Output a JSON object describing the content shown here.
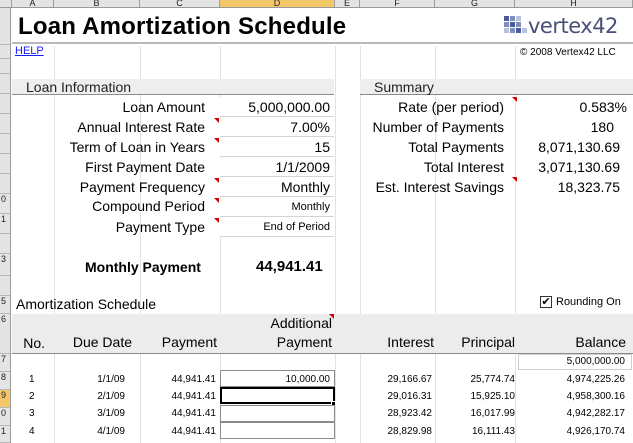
{
  "app": {
    "columns": [
      "A",
      "B",
      "C",
      "D",
      "E",
      "F",
      "G",
      "H"
    ],
    "selected_column": "D",
    "rows": [
      "",
      "",
      "",
      "",
      "",
      "",
      "",
      "",
      "",
      "",
      "",
      "",
      "",
      "",
      "",
      "",
      "",
      "",
      "",
      "",
      "",
      "",
      "",
      "0",
      "1",
      "",
      "3",
      "",
      "5",
      "",
      "",
      "7",
      "3",
      "9",
      "0",
      "1"
    ],
    "selected_row": "9"
  },
  "header": {
    "title": "Loan Amortization Schedule",
    "logo_text": "vertex42",
    "help_label": "HELP",
    "copyright": "© 2008 Vertex42 LLC"
  },
  "loan_info": {
    "section_title": "Loan Information",
    "fields": [
      {
        "label": "Loan Amount",
        "value": "5,000,000.00",
        "note": false
      },
      {
        "label": "Annual Interest Rate",
        "value": "7.00%",
        "note": true
      },
      {
        "label": "Term of Loan in Years",
        "value": "15",
        "note": true
      },
      {
        "label": "First Payment Date",
        "value": "1/1/2009",
        "note": false
      },
      {
        "label": "Payment Frequency",
        "value": "Monthly",
        "note": true
      },
      {
        "label": "Compound Period",
        "value": "Monthly",
        "note": true
      },
      {
        "label": "Payment Type",
        "value": "End of Period",
        "note": true
      }
    ],
    "monthly_payment_label": "Monthly Payment",
    "monthly_payment_value": "44,941.41"
  },
  "summary": {
    "section_title": "Summary",
    "fields": [
      {
        "label": "Rate (per period)",
        "value": "0.583%",
        "note": true
      },
      {
        "label": "Number of Payments",
        "value": "180",
        "note": false
      },
      {
        "label": "Total Payments",
        "value": "8,071,130.69",
        "note": false
      },
      {
        "label": "Total Interest",
        "value": "3,071,130.69",
        "note": false
      },
      {
        "label": "Est. Interest Savings",
        "value": "18,323.75",
        "note": true
      }
    ]
  },
  "schedule": {
    "section_title": "Amortization Schedule",
    "rounding_label": "Rounding On",
    "rounding_checked": true,
    "rounding_mark": "✔",
    "headers": {
      "no": "No.",
      "due_date": "Due Date",
      "payment": "Payment",
      "additional_line1": "Additional",
      "additional_line2": "Payment",
      "interest": "Interest",
      "principal": "Principal",
      "balance": "Balance"
    },
    "starting_balance": "5,000,000.00",
    "rows": [
      {
        "no": "1",
        "date": "1/1/09",
        "payment": "44,941.41",
        "additional": "10,000.00",
        "interest": "29,166.67",
        "principal": "25,774.74",
        "balance": "4,974,225.26"
      },
      {
        "no": "2",
        "date": "2/1/09",
        "payment": "44,941.41",
        "additional": "",
        "interest": "29,016.31",
        "principal": "15,925.10",
        "balance": "4,958,300.16"
      },
      {
        "no": "3",
        "date": "3/1/09",
        "payment": "44,941.41",
        "additional": "",
        "interest": "28,923.42",
        "principal": "16,017.99",
        "balance": "4,942,282.17"
      },
      {
        "no": "4",
        "date": "4/1/09",
        "payment": "44,941.41",
        "additional": "",
        "interest": "28,829.98",
        "principal": "16,111.43",
        "balance": "4,926,170.74"
      }
    ]
  },
  "colors": {
    "selection": "#f4c86a",
    "note_marker": "#d40000",
    "link": "#1a1aff",
    "section_bar": "#eeeeee"
  }
}
